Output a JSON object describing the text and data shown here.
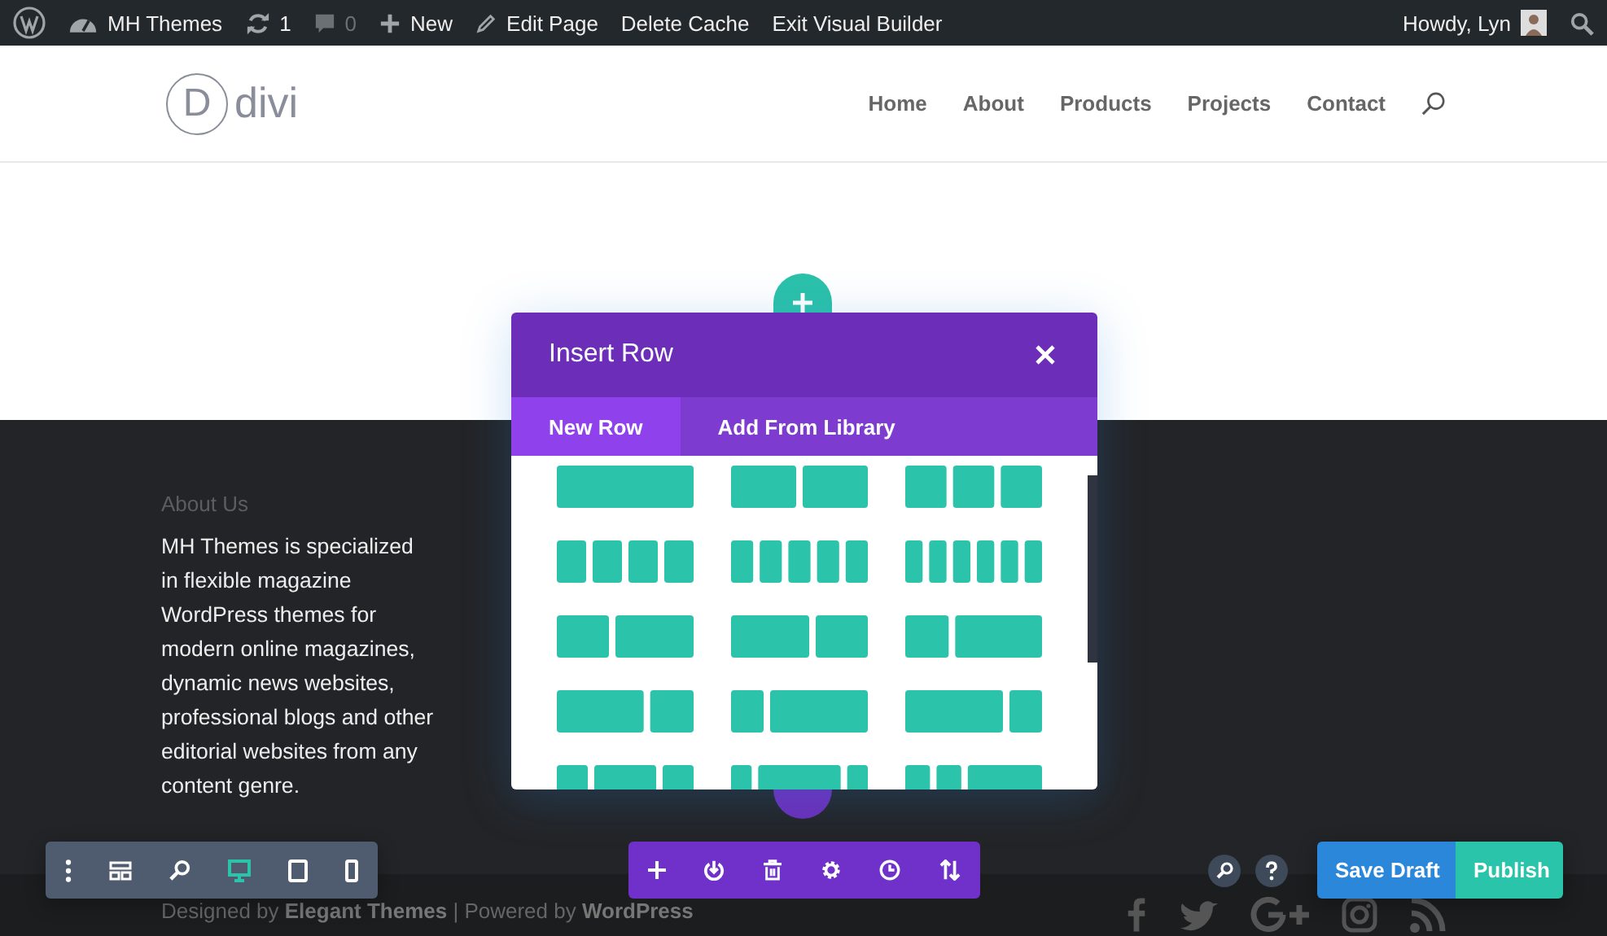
{
  "admin_bar": {
    "site": "MH Themes",
    "updates": "1",
    "comments": "0",
    "new": "New",
    "edit": "Edit Page",
    "cache": "Delete Cache",
    "exit": "Exit Visual Builder",
    "greeting": "Howdy, Lyn"
  },
  "header": {
    "logo_mark": "D",
    "logo_text": "divi",
    "nav": [
      "Home",
      "About",
      "Products",
      "Projects",
      "Contact"
    ]
  },
  "modal": {
    "title": "Insert Row",
    "tabs": [
      {
        "label": "New Row",
        "selected": true
      },
      {
        "label": "Add From Library",
        "selected": false
      }
    ]
  },
  "footer": {
    "heading": "About Us",
    "text": "MH Themes is specialized in flexible magazine WordPress themes for modern online magazines, dynamic news websites, professional blogs and other editorial websites from any content genre.",
    "credits": "Designed by **Elegant Themes** | Powered by **WordPress**"
  },
  "builder": {
    "view_modes": [
      {
        "kind": "desktop",
        "selected": true
      },
      {
        "kind": "tablet",
        "selected": false
      },
      {
        "kind": "phone",
        "selected": false
      }
    ],
    "save": "Save Draft",
    "publish": "Publish"
  }
}
